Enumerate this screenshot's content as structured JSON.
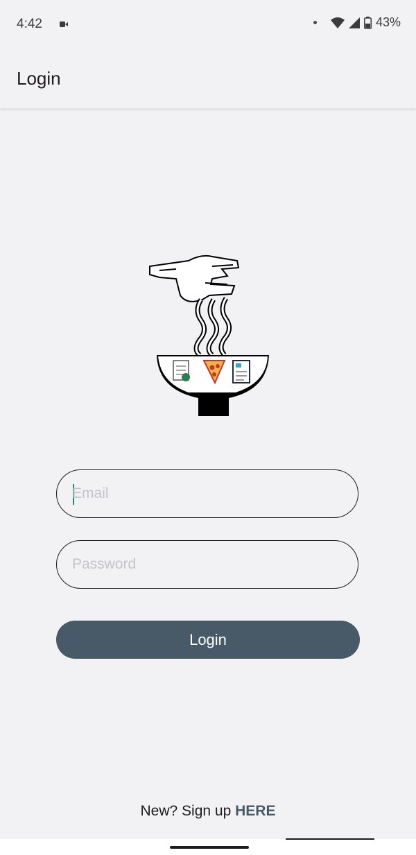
{
  "status_bar": {
    "time": "4:42",
    "battery_percent": "43%",
    "icons": [
      "video-recording-icon",
      "notification-dot-icon",
      "wifi-icon",
      "cellular-signal-icon",
      "battery-icon"
    ]
  },
  "app_bar": {
    "title": "Login"
  },
  "logo": {
    "icon": "noodle-bowl-logo"
  },
  "form": {
    "email_placeholder": "Email",
    "email_value": "",
    "password_placeholder": "Password",
    "password_value": "",
    "login_label": "Login"
  },
  "signup": {
    "prefix": "New? Sign up ",
    "link": "HERE"
  },
  "colors": {
    "background": "#f2f1f4",
    "button": "#485a67",
    "caret": "#1f8a70"
  }
}
